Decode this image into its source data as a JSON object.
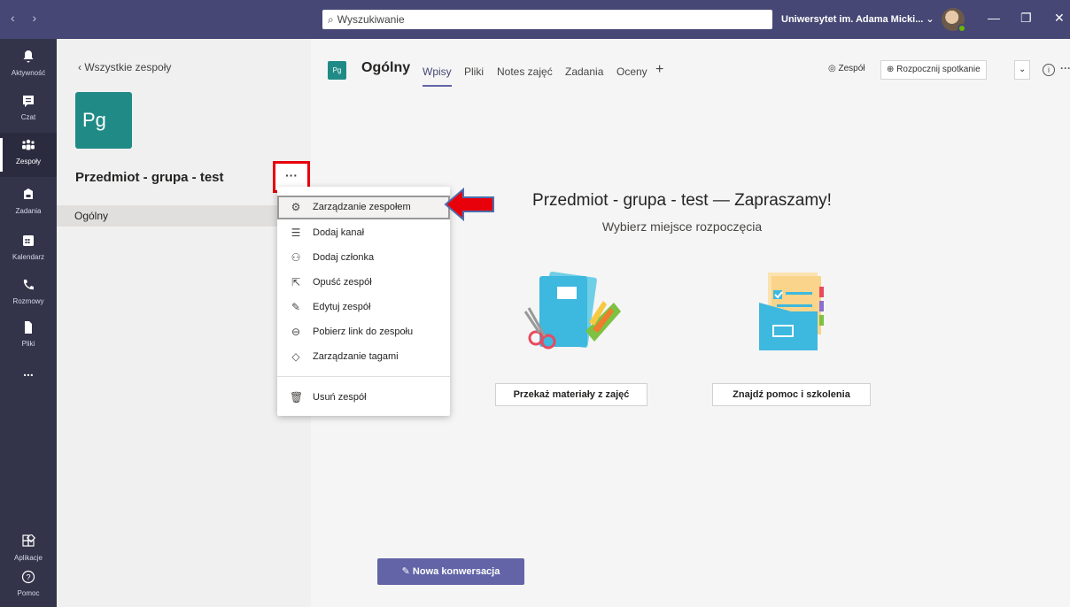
{
  "titlebar": {
    "nav": "‹ ›",
    "search_placeholder": "Wyszukiwanie",
    "org": "Uniwersytet im. Adama Micki...  ⌄",
    "minimize": "—",
    "restore": "❐",
    "close": "✕"
  },
  "rail": {
    "items": [
      {
        "label": "Aktywność",
        "icon": "bell-icon"
      },
      {
        "label": "Czat",
        "icon": "chat-icon"
      },
      {
        "label": "Zespoły",
        "icon": "teams-icon"
      },
      {
        "label": "Zadania",
        "icon": "assignments-icon"
      },
      {
        "label": "Kalendarz",
        "icon": "calendar-icon"
      },
      {
        "label": "Rozmowy",
        "icon": "phone-icon"
      },
      {
        "label": "Pliki",
        "icon": "file-icon"
      },
      {
        "label": "...",
        "icon": "more-icon"
      },
      {
        "label": "Aplikacje",
        "icon": "apps-icon"
      },
      {
        "label": "Pomoc",
        "icon": "help-icon"
      }
    ]
  },
  "pane": {
    "back_label": "Wszystkie zespoły",
    "team_initials": "Pg",
    "team_name": "Przedmiot - grupa - test",
    "more": "···",
    "channel": "Ogólny"
  },
  "menu": {
    "items": [
      {
        "label": "Zarządzanie zespołem",
        "icon": "gear-icon",
        "glyph": "⚙"
      },
      {
        "label": "Dodaj kanał",
        "icon": "add-channel-icon",
        "glyph": "☰"
      },
      {
        "label": "Dodaj członka",
        "icon": "add-person-icon",
        "glyph": "⚇"
      },
      {
        "label": "Opuść zespół",
        "icon": "leave-icon",
        "glyph": "⇱"
      },
      {
        "label": "Edytuj zespół",
        "icon": "pencil-icon",
        "glyph": "✎"
      },
      {
        "label": "Pobierz link do zespołu",
        "icon": "link-icon",
        "glyph": "⊖"
      },
      {
        "label": "Zarządzanie tagami",
        "icon": "tag-icon",
        "glyph": "◇"
      },
      {
        "label": "Usuń zespół",
        "icon": "trash-icon",
        "glyph": "🗑"
      }
    ]
  },
  "main": {
    "channel_badge": "Pg",
    "channel_title": "Ogólny",
    "tabs": [
      "Wpisy",
      "Pliki",
      "Notes zajęć",
      "Zadania",
      "Oceny"
    ],
    "tab_add": "+",
    "team_btn": "◎ Zespół",
    "meet_btn": "⊕ Rozpocznij spotkanie",
    "meet_caret": "⌄",
    "info": "i",
    "more": "···",
    "welcome": "Przedmiot - grupa - test — Zapraszamy!",
    "subtitle": "Wybierz miejsce rozpoczęcia",
    "card1": "Przekaż materiały z zajęć",
    "card2": "Znajdź pomoc i szkolenia",
    "new_conversation": "Nowa konwersacja"
  },
  "colors": {
    "titlebar": "#464775",
    "rail": "#33344a",
    "accent": "#6264a7",
    "team": "#208b86",
    "highlight": "#e8000b"
  }
}
